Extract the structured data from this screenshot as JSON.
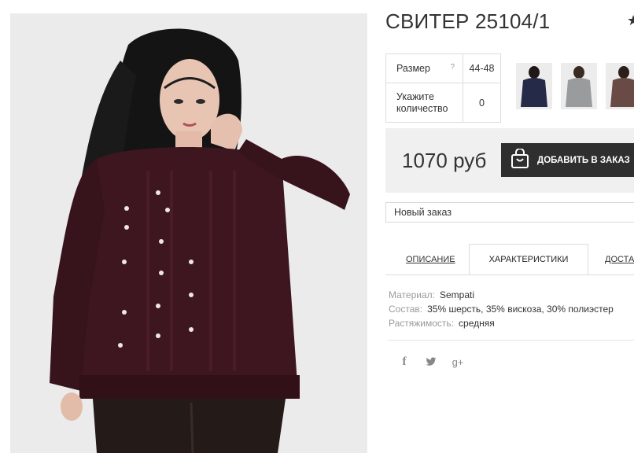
{
  "product": {
    "title": "СВИТЕР 25104/1",
    "star_icon": "star-icon"
  },
  "options": {
    "size_label": "Размер",
    "size_help": "?",
    "size_value": "44-48",
    "qty_label_1": "Укажите",
    "qty_label_2": "количество",
    "qty_value": "0"
  },
  "thumbnails": [
    {
      "name": "thumb-burgundy",
      "color": "#2a2f4a"
    },
    {
      "name": "thumb-grey",
      "color": "#9c9c9c"
    },
    {
      "name": "thumb-brown",
      "color": "#6a4a44"
    }
  ],
  "buy": {
    "price": "1070 руб",
    "cart_label": "ДОБАВИТЬ В ЗАКАЗ",
    "cart_icon": "shopping-bag-icon"
  },
  "order_select": {
    "value": "Новый заказ"
  },
  "tabs": {
    "description": "ОПИСАНИЕ",
    "characteristics": "ХАРАКТЕРИСТИКИ",
    "delivery": "ДОСТАВКА"
  },
  "characteristics": [
    {
      "key": "Материал:",
      "value": "Sempati"
    },
    {
      "key": "Состав:",
      "value": "35% шерсть, 35% вискоза, 30% полиэстер"
    },
    {
      "key": "Растяжимость:",
      "value": "средняя"
    }
  ],
  "social": {
    "facebook": "f",
    "twitter": "🐦",
    "google": "g+"
  },
  "colors": {
    "sweater": "#3d1620",
    "button_bg": "#2f2f2f",
    "buybox_bg": "#f0f0f0"
  }
}
